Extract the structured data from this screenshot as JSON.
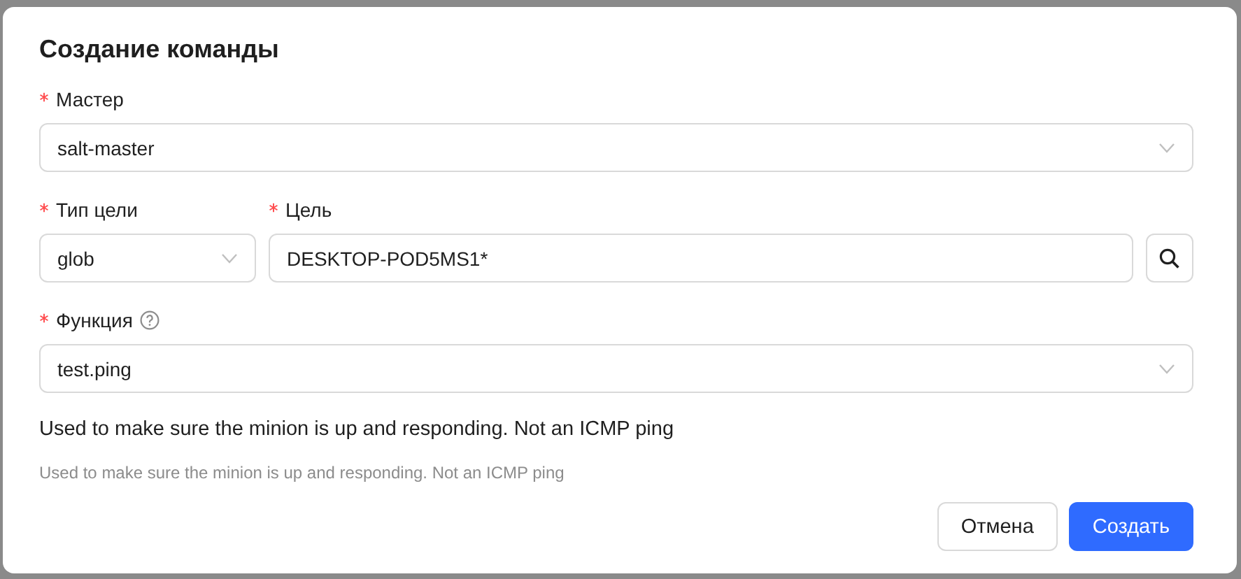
{
  "dialog": {
    "title": "Создание команды",
    "master": {
      "label": "Мастер",
      "required": true,
      "kind": "select",
      "value": "salt-master"
    },
    "target_type": {
      "label": "Тип цели",
      "required": true,
      "kind": "select",
      "value": "glob"
    },
    "target": {
      "label": "Цель",
      "required": true,
      "kind": "input",
      "value": "DESKTOP-POD5MS1*"
    },
    "function": {
      "label": "Функция",
      "required": true,
      "help": true,
      "kind": "select",
      "value": "test.ping"
    },
    "description": "Used to make sure the minion is up and responding. Not an ICMP ping",
    "hint": "Used to make sure the minion is up and responding. Not an ICMP ping",
    "buttons": [
      {
        "label": "Отмена",
        "kind": "default"
      },
      {
        "label": "Создать",
        "kind": "primary"
      }
    ]
  }
}
